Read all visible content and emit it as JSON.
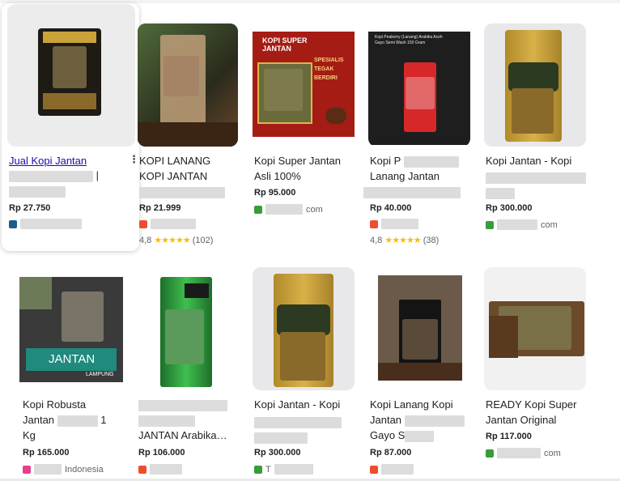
{
  "products": [
    {
      "title": "Jual Kopi Jantan",
      "price": "Rp 27.750"
    },
    {
      "title": "KOPI LANANG KOPI JANTAN",
      "price": "Rp 21.999",
      "rating": "4,8",
      "stars": "★★★★★",
      "reviews": "(102)"
    },
    {
      "title": "Kopi Super Jantan Asli 100%",
      "price": "Rp 95.000",
      "seller_suffix": "com"
    },
    {
      "title_start": "Kopi P",
      "title_rest": "Lanang Jantan",
      "price": "Rp 40.000",
      "rating": "4,8",
      "stars": "★★★★★",
      "reviews": "(38)"
    },
    {
      "title": "Kopi Jantan - Kopi",
      "price": "Rp 300.000",
      "seller_suffix": "com"
    },
    {
      "title_l1": "Kopi Robusta",
      "title_l2_start": "Jantan",
      "title_l2_end": "1",
      "title_l3": "Kg",
      "price": "Rp 165.000",
      "seller_suffix": "Indonesia"
    },
    {
      "title_l2": "JANTAN Arabika…",
      "price": "Rp 106.000"
    },
    {
      "title": "Kopi Jantan - Kopi",
      "price": "Rp 300.000",
      "seller_prefix": "T"
    },
    {
      "title_l1": "Kopi Lanang Kopi",
      "title_l2": "Jantan",
      "title_l3": "Gayo S",
      "price": "Rp 87.000"
    },
    {
      "title": "READY Kopi Super Jantan Original",
      "price": "Rp 117.000",
      "seller_suffix": "com"
    }
  ],
  "thumb_texts": {
    "p3_banner": "KOPI SUPER JANTAN",
    "p3_side": "SPESIALIS TEGAK BERDIRI",
    "p4_label": "Kopi Peaberry (Lanang) Arabika Aceh Gayo Semi Wash 150 Gram",
    "p6_banner": "JANTAN",
    "p6_sub": "LAMPUNG"
  },
  "icons": {
    "more": "⋮"
  }
}
